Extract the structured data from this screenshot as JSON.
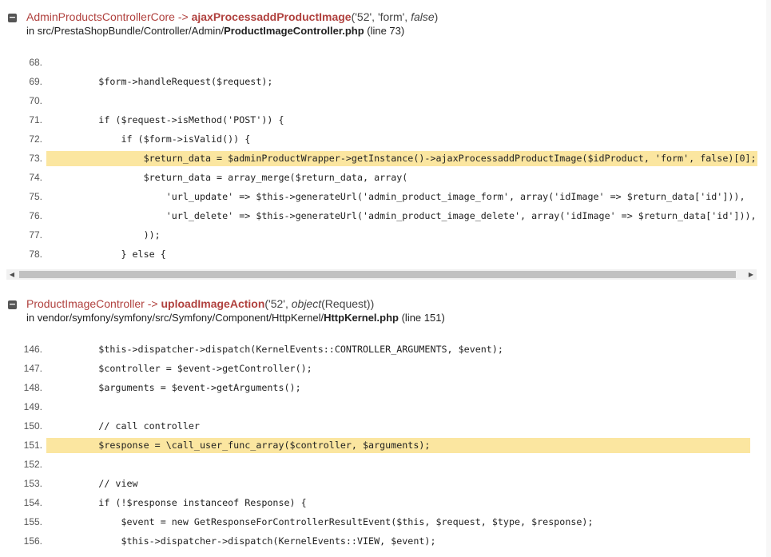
{
  "frames": [
    {
      "class_name": "AdminProductsControllerCore",
      "arrow": "->",
      "method": "ajaxProcessaddProductImage",
      "args_open": "('52', 'form', ",
      "args_italic": "false",
      "args_close": ")",
      "file_prefix": "in src/PrestaShopBundle/Controller/Admin/",
      "file_name": "ProductImageController.php",
      "file_suffix": " (line 73)",
      "lines": [
        {
          "n": "68.",
          "code": ""
        },
        {
          "n": "69.",
          "code": "        $form->handleRequest($request);"
        },
        {
          "n": "70.",
          "code": ""
        },
        {
          "n": "71.",
          "code": "        if ($request->isMethod('POST')) {"
        },
        {
          "n": "72.",
          "code": "            if ($form->isValid()) {"
        },
        {
          "n": "73.",
          "code": "                $return_data = $adminProductWrapper->getInstance()->ajaxProcessaddProductImage($idProduct, 'form', false)[0];",
          "highlight": true
        },
        {
          "n": "74.",
          "code": "                $return_data = array_merge($return_data, array("
        },
        {
          "n": "75.",
          "code": "                    'url_update' => $this->generateUrl('admin_product_image_form', array('idImage' => $return_data['id'])),"
        },
        {
          "n": "76.",
          "code": "                    'url_delete' => $this->generateUrl('admin_product_image_delete', array('idImage' => $return_data['id'])),"
        },
        {
          "n": "77.",
          "code": "                ));"
        },
        {
          "n": "78.",
          "code": "            } else {"
        }
      ]
    },
    {
      "class_name": "ProductImageController",
      "arrow": "->",
      "method": "uploadImageAction",
      "args_open": "('52', ",
      "args_italic": "object",
      "args_close": "(Request))",
      "file_prefix": "in vendor/symfony/symfony/src/Symfony/Component/HttpKernel/",
      "file_name": "HttpKernel.php",
      "file_suffix": " (line 151)",
      "lines": [
        {
          "n": "146.",
          "code": "        $this->dispatcher->dispatch(KernelEvents::CONTROLLER_ARGUMENTS, $event);"
        },
        {
          "n": "147.",
          "code": "        $controller = $event->getController();"
        },
        {
          "n": "148.",
          "code": "        $arguments = $event->getArguments();"
        },
        {
          "n": "149.",
          "code": ""
        },
        {
          "n": "150.",
          "code": "        // call controller"
        },
        {
          "n": "151.",
          "code": "        $response = \\call_user_func_array($controller, $arguments);",
          "highlight": true
        },
        {
          "n": "152.",
          "code": ""
        },
        {
          "n": "153.",
          "code": "        // view"
        },
        {
          "n": "154.",
          "code": "        if (!$response instanceof Response) {"
        },
        {
          "n": "155.",
          "code": "            $event = new GetResponseForControllerResultEvent($this, $request, $type, $response);"
        },
        {
          "n": "156.",
          "code": "            $this->dispatcher->dispatch(KernelEvents::VIEW, $event);"
        }
      ]
    }
  ],
  "scroll_left_glyph": "◀",
  "scroll_right_glyph": "▶",
  "toggle_glyph": "−"
}
